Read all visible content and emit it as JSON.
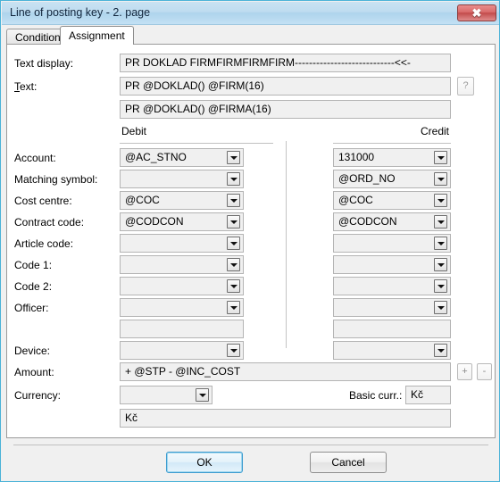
{
  "window": {
    "title": "Line of posting key - 2. page",
    "close_label": "✖"
  },
  "tabs": [
    {
      "label": "Conditions",
      "active": false
    },
    {
      "label": "Assignment",
      "active": true
    }
  ],
  "top_fields": {
    "text_display_label": "Text display:",
    "text_display_value": "PR DOKLAD FIRMFIRMFIRMFIRM----------------------------<<-",
    "text_label": "Text:",
    "text_value": "PR @DOKLAD() @FIRM(16)",
    "text_value2": "PR @DOKLAD() @FIRMA(16)",
    "help_label": "?"
  },
  "columns": {
    "debit_header": "Debit",
    "credit_header": "Credit"
  },
  "rows": [
    {
      "label": "Account:",
      "debit": "@AC_STNO",
      "credit": "131000",
      "combo": true
    },
    {
      "label": "Matching symbol:",
      "debit": "",
      "credit": "@ORD_NO",
      "combo": true
    },
    {
      "label": "Cost centre:",
      "debit": "@COC",
      "credit": "@COC",
      "combo": true
    },
    {
      "label": "Contract code:",
      "debit": "@CODCON",
      "credit": "@CODCON",
      "combo": true
    },
    {
      "label": "Article code:",
      "debit": "",
      "credit": "",
      "combo": true
    },
    {
      "label": "Code 1:",
      "debit": "",
      "credit": "",
      "combo": true
    },
    {
      "label": "Code 2:",
      "debit": "",
      "credit": "",
      "combo": true
    },
    {
      "label": "Officer:",
      "debit": "",
      "credit": "",
      "combo": true
    },
    {
      "label": "",
      "debit": "",
      "credit": "",
      "combo": false
    },
    {
      "label": "Device:",
      "debit": "",
      "credit": "",
      "combo": true
    }
  ],
  "amount": {
    "label": "Amount:",
    "value": "+ @STP - @INC_COST",
    "plus_label": "+",
    "minus_label": "-"
  },
  "currency": {
    "label": "Currency:",
    "value": "",
    "basic_label": "Basic curr.:",
    "basic_value": "Kč",
    "bottom_value": "Kč"
  },
  "footer": {
    "ok_label": "OK",
    "cancel_label": "Cancel"
  },
  "colors": {
    "accent": "#4ab2d8",
    "title_bg": "#bedcf0",
    "close_red": "#c24b4b"
  }
}
